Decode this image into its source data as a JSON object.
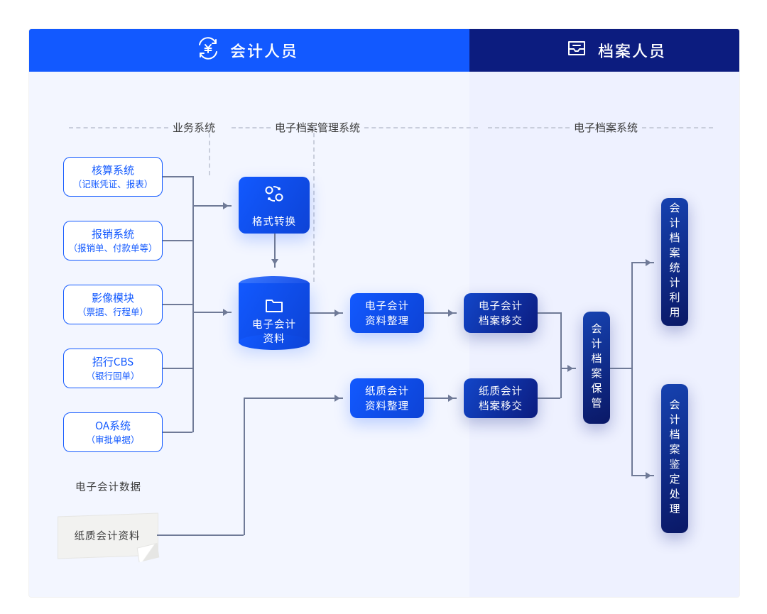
{
  "header": {
    "left_title": "会计人员",
    "right_title": "档案人员"
  },
  "sections": {
    "biz": "业务系统",
    "edms": "电子档案管理系统",
    "eas": "电子档案系统"
  },
  "sources_label": "电子会计数据",
  "sources": [
    {
      "title": "核算系统",
      "sub": "（记账凭证、报表）"
    },
    {
      "title": "报销系统",
      "sub": "（报销单、付款单等）"
    },
    {
      "title": "影像模块",
      "sub": "（票据、行程单）"
    },
    {
      "title": "招行CBS",
      "sub": "（银行回单）"
    },
    {
      "title": "OA系统",
      "sub": "（审批单据）"
    }
  ],
  "paper_note": "纸质会计资料",
  "nodes": {
    "format": "格式转换",
    "cylinder_l1": "电子会计",
    "cylinder_l2": "资料",
    "e_sort_l1": "电子会计",
    "e_sort_l2": "资料整理",
    "p_sort_l1": "纸质会计",
    "p_sort_l2": "资料整理",
    "e_xfer_l1": "电子会计",
    "e_xfer_l2": "档案移交",
    "p_xfer_l1": "纸质会计",
    "p_xfer_l2": "档案移交",
    "keep": "会计档案保管",
    "stat": "会计档案统计利用",
    "dispose": "会计档案鉴定处理"
  }
}
